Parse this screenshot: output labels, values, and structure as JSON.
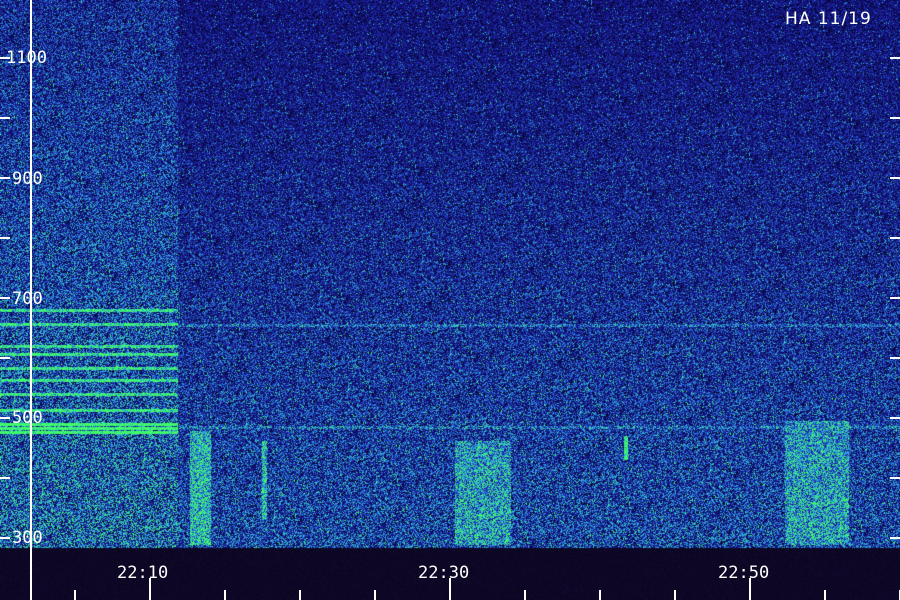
{
  "title": "HA 11/19",
  "chart_data": {
    "type": "heatmap",
    "title": "HA 11/19",
    "y_ticks": [
      "300",
      "500",
      "700",
      "900",
      "1100"
    ],
    "x_ticks": [
      "22:10",
      "22:30",
      "22:50"
    ],
    "colors": {
      "background": "#02052a",
      "low": "#1a1aa0",
      "mid": "#2f8fe0",
      "high": "#39ff66",
      "axis": "#ffffff"
    }
  }
}
